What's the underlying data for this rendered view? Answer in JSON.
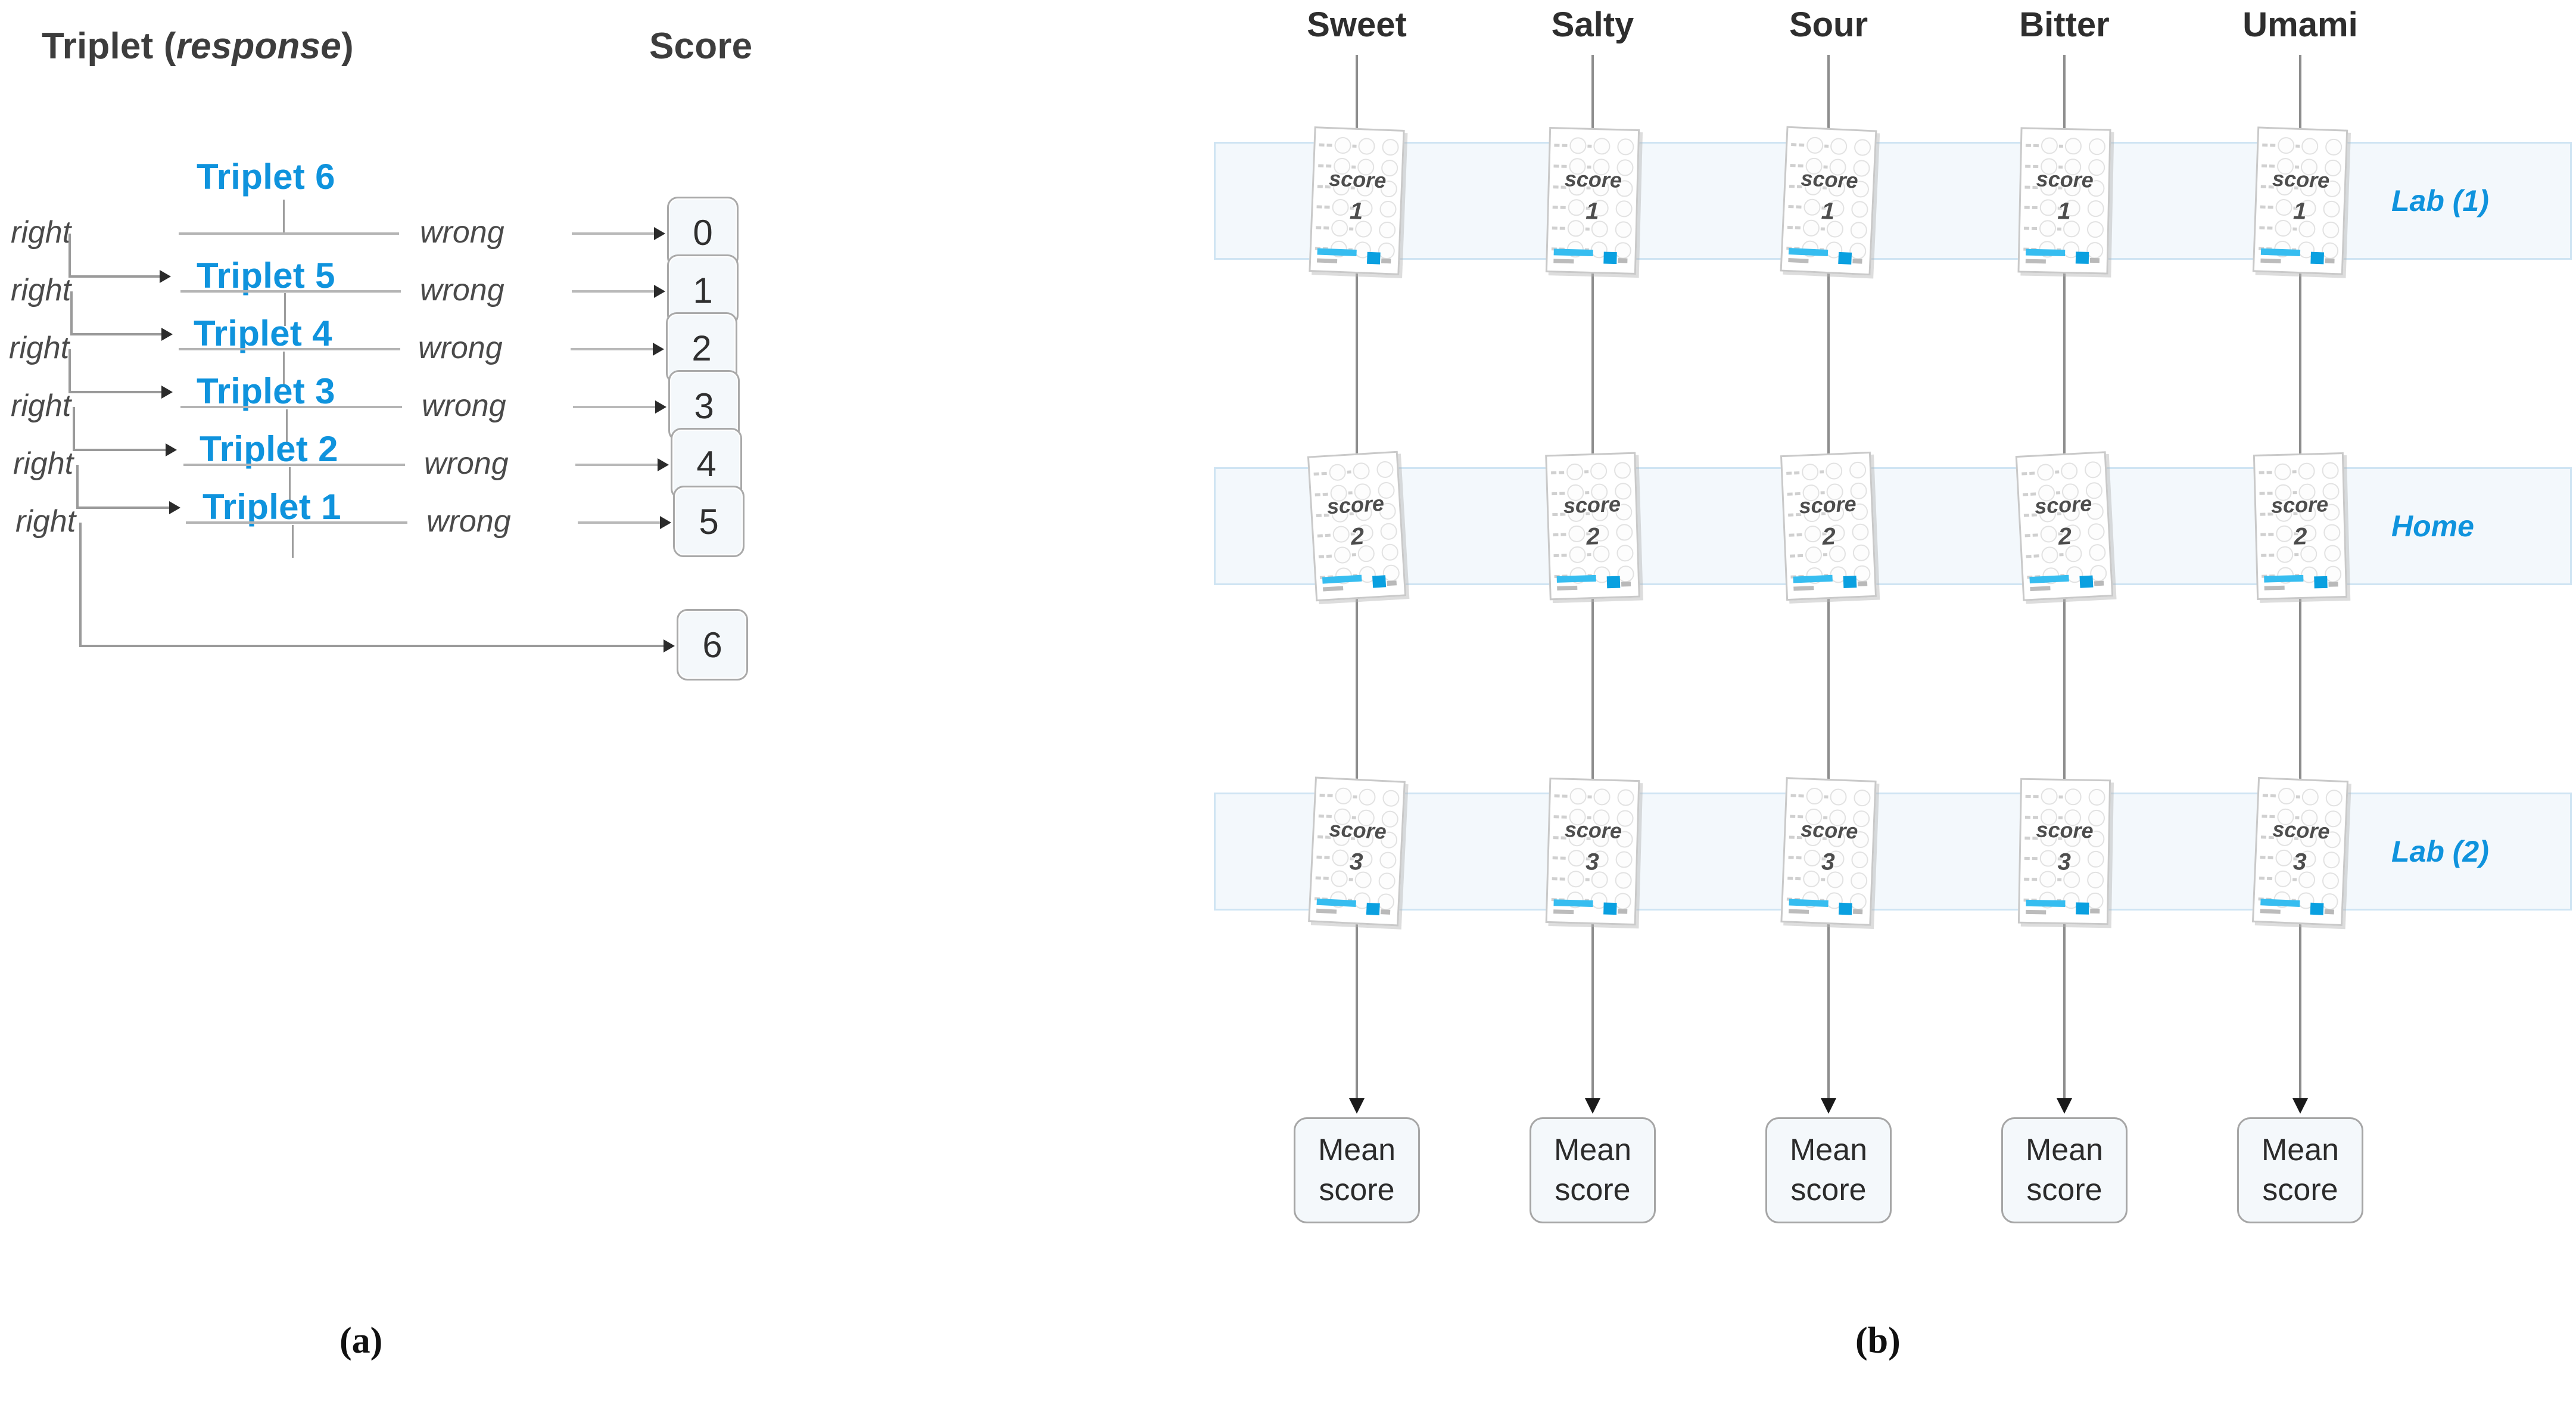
{
  "figure": {
    "panel_a_label": "(a)",
    "panel_b_label": "(b)"
  },
  "panel_a": {
    "headers": {
      "triplet_prefix": "Triplet (",
      "triplet_italic": "response",
      "triplet_suffix": ")",
      "score": "Score"
    },
    "branch_labels": {
      "right": "right",
      "wrong": "wrong"
    },
    "nodes": [
      {
        "triplet": "Triplet 6",
        "wrong_score": "0"
      },
      {
        "triplet": "Triplet 5",
        "wrong_score": "1"
      },
      {
        "triplet": "Triplet 4",
        "wrong_score": "2"
      },
      {
        "triplet": "Triplet 3",
        "wrong_score": "3"
      },
      {
        "triplet": "Triplet 2",
        "wrong_score": "4"
      },
      {
        "triplet": "Triplet 1",
        "wrong_score": "5"
      }
    ],
    "terminal_score": "6",
    "colors": {
      "triplet_blue": "#0f93dd",
      "box_fill": "#f4f8fb",
      "box_border": "#a9a9a9"
    }
  },
  "panel_b": {
    "tastes": [
      "Sweet",
      "Salty",
      "Sour",
      "Bitter",
      "Umami"
    ],
    "sessions": [
      {
        "label": "Lab (1)",
        "card_caption": "score",
        "card_value": "1"
      },
      {
        "label": "Home",
        "card_caption": "score",
        "card_value": "2"
      },
      {
        "label": "Lab (2)",
        "card_caption": "score",
        "card_value": "3"
      }
    ],
    "outputs": [
      {
        "line1": "Mean",
        "line2": "score"
      },
      {
        "line1": "Mean",
        "line2": "score"
      },
      {
        "line1": "Mean",
        "line2": "score"
      },
      {
        "line1": "Mean",
        "line2": "score"
      },
      {
        "line1": "Mean",
        "line2": "score"
      }
    ],
    "colors": {
      "band_fill": "#f3f8fc",
      "band_border": "#cfe4f3",
      "label_blue": "#0f93dd",
      "card_accent": "#0aa0e0"
    }
  }
}
